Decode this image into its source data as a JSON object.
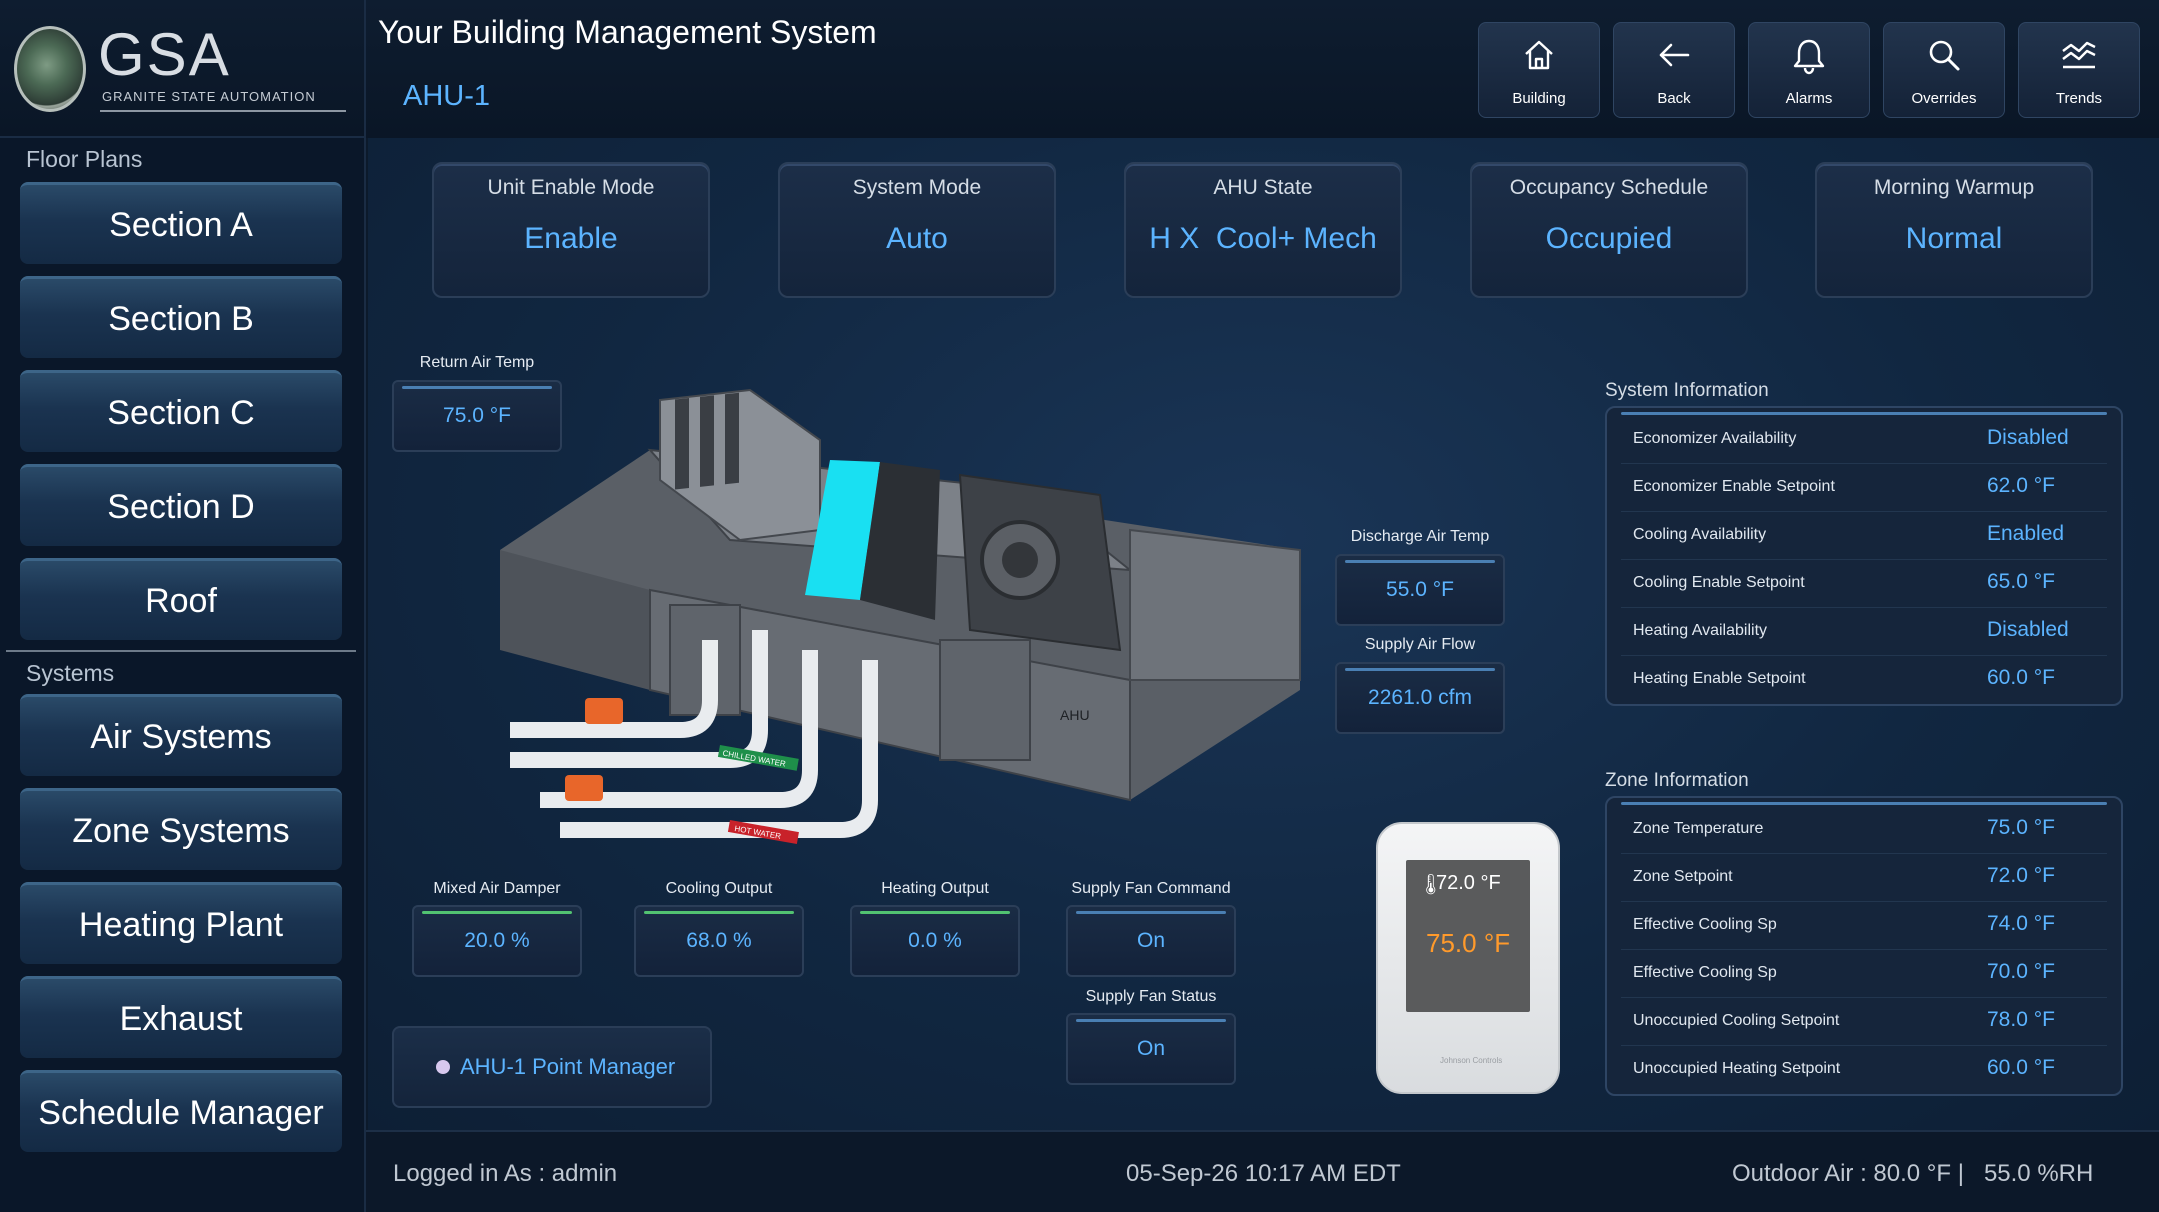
{
  "brand": {
    "name": "GSA",
    "tagline": "GRANITE STATE AUTOMATION"
  },
  "header": {
    "title": "Your Building Management System",
    "subtitle": "AHU-1"
  },
  "nav": [
    {
      "label": "Building",
      "icon": "home-icon"
    },
    {
      "label": "Back",
      "icon": "back-arrow-icon"
    },
    {
      "label": "Alarms",
      "icon": "bell-icon"
    },
    {
      "label": "Overrides",
      "icon": "search-icon"
    },
    {
      "label": "Trends",
      "icon": "trend-icon"
    }
  ],
  "sidebar": {
    "floor_plans_label": "Floor Plans",
    "floor_plans": [
      "Section A",
      "Section B",
      "Section C",
      "Section D",
      "Roof"
    ],
    "systems_label": "Systems",
    "systems": [
      "Air Systems",
      "Zone Systems",
      "Heating Plant",
      "Exhaust",
      "Schedule Manager"
    ]
  },
  "modes": [
    {
      "title": "Unit Enable Mode",
      "value": "Enable"
    },
    {
      "title": "System Mode",
      "value": "Auto"
    },
    {
      "title": "AHU State",
      "value": "H X  Cool+ Mech"
    },
    {
      "title": "Occupancy Schedule",
      "value": "Occupied"
    },
    {
      "title": "Morning Warmup",
      "value": "Normal"
    }
  ],
  "points": {
    "return_air_temp": {
      "label": "Return Air Temp",
      "value": "75.0 °F"
    },
    "discharge_air_temp": {
      "label": "Discharge Air Temp",
      "value": "55.0 °F"
    },
    "supply_air_flow": {
      "label": "Supply Air Flow",
      "value": "2261.0 cfm"
    },
    "mixed_air_damper": {
      "label": "Mixed Air Damper",
      "value": "20.0 %"
    },
    "cooling_output": {
      "label": "Cooling Output",
      "value": "68.0 %"
    },
    "heating_output": {
      "label": "Heating Output",
      "value": "0.0 %"
    },
    "supply_fan_command": {
      "label": "Supply Fan Command",
      "value": "On"
    },
    "supply_fan_status": {
      "label": "Supply Fan Status",
      "value": "On"
    }
  },
  "ahu_labels": {
    "chilled_water": "CHILLED WATER",
    "hot_water": "HOT WATER",
    "unit": "AHU"
  },
  "system_info": {
    "title": "System Information",
    "rows": [
      {
        "k": "Economizer Availability",
        "v": "Disabled"
      },
      {
        "k": "Economizer Enable Setpoint",
        "v": "62.0 °F"
      },
      {
        "k": "Cooling Availability",
        "v": "Enabled"
      },
      {
        "k": "Cooling Enable Setpoint",
        "v": "65.0 °F"
      },
      {
        "k": "Heating Availability",
        "v": "Disabled"
      },
      {
        "k": "Heating Enable Setpoint",
        "v": "60.0 °F"
      }
    ]
  },
  "zone_info": {
    "title": "Zone Information",
    "rows": [
      {
        "k": "Zone Temperature",
        "v": "75.0 °F"
      },
      {
        "k": "Zone Setpoint",
        "v": "72.0 °F"
      },
      {
        "k": "Effective Cooling Sp",
        "v": "74.0 °F"
      },
      {
        "k": "Effective Cooling Sp",
        "v": "70.0 °F"
      },
      {
        "k": "Unoccupied Cooling Setpoint",
        "v": "78.0 °F"
      },
      {
        "k": "Unoccupied Heating Setpoint",
        "v": "60.0 °F"
      }
    ]
  },
  "thermostat": {
    "setpoint": "72.0 °F",
    "temperature": "75.0 °F",
    "brand": "Johnson Controls"
  },
  "point_manager": {
    "label": "AHU-1 Point Manager"
  },
  "footer": {
    "user": "Logged in As : admin",
    "datetime": "05-Sep-26 10:17 AM EDT",
    "outdoor": "Outdoor Air : 80.0 °F |   55.0 %RH"
  },
  "colors": {
    "accent": "#5cb4ff",
    "background": "#0c1a2b",
    "thermostat_value": "#ff9a2b"
  }
}
